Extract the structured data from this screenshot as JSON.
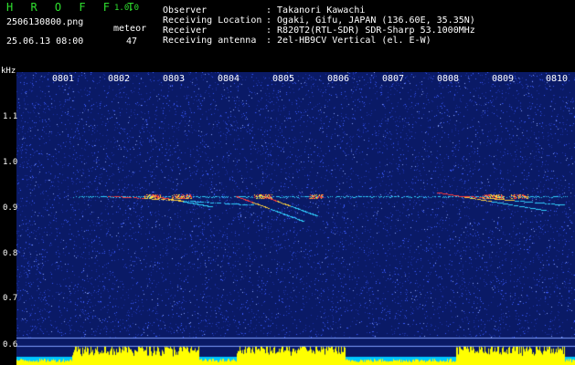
{
  "header": {
    "logo": "H R O F F T",
    "version": "1.0.0",
    "filename": "2506130800.png",
    "datetime": "25.06.13 08:00",
    "meteor_label": "meteor",
    "meteor_count": "47",
    "labels": [
      "Observer",
      "Receiving Location",
      "Receiver",
      "Receiving antenna"
    ],
    "values": [
      ": Takanori Kawachi",
      ": Ogaki, Gifu, JAPAN (136.60E, 35.35N)",
      ": R820T2(RTL-SDR) SDR-Sharp 53.1000MHz",
      ": 2el-HB9CV Vertical (el. E-W)"
    ]
  },
  "plot": {
    "yunit": "kHz",
    "yticks": [
      "1.1",
      "1.0",
      "0.9",
      "0.8",
      "0.7",
      "0.6"
    ],
    "xticks": [
      "0801",
      "0802",
      "0803",
      "0804",
      "0805",
      "0806",
      "0807",
      "0808",
      "0809",
      "0810"
    ],
    "colors": {
      "background": "#0a1a66",
      "noise": "#3a5cff",
      "signal": "#30d0ff",
      "meteor": "#ff3b3b",
      "level": "#ffff00"
    }
  }
}
